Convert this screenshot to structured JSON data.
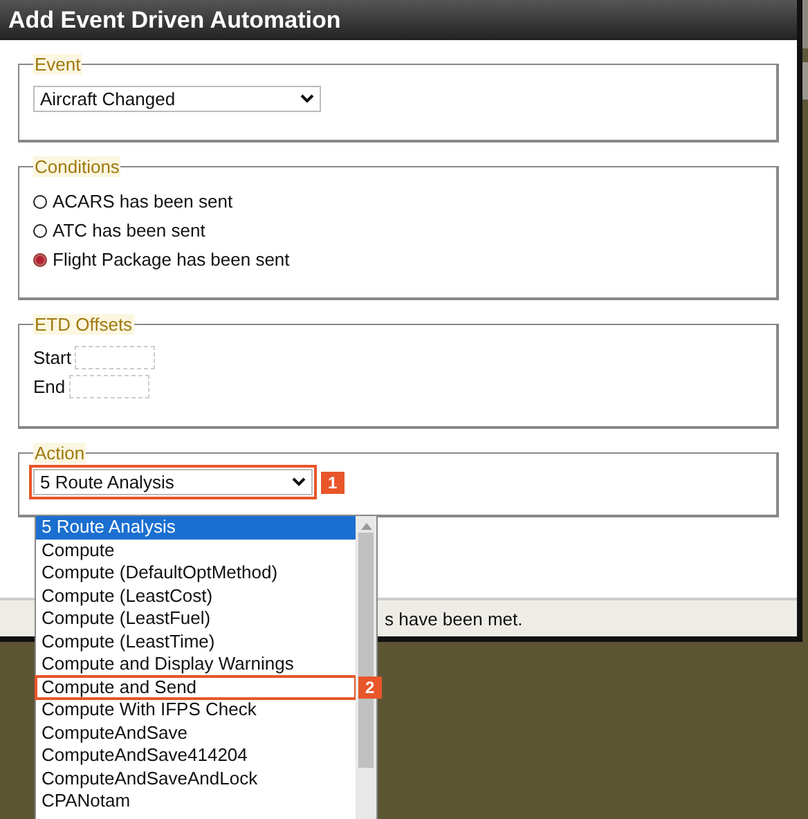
{
  "window": {
    "title": "Add Event Driven Automation"
  },
  "event": {
    "legend": "Event",
    "value": "Aircraft Changed"
  },
  "conditions": {
    "legend": "Conditions",
    "items": [
      {
        "label": "ACARS has been sent",
        "selected": false
      },
      {
        "label": "ATC has been sent",
        "selected": false
      },
      {
        "label": "Flight Package has been sent",
        "selected": true
      }
    ]
  },
  "etd_offsets": {
    "legend": "ETD Offsets",
    "fields": [
      {
        "label": "Start"
      },
      {
        "label": "End"
      }
    ]
  },
  "action": {
    "legend": "Action",
    "value": "5 Route Analysis",
    "callout": "1",
    "options": [
      {
        "label": "5 Route Analysis",
        "selected": true,
        "highlighted": false
      },
      {
        "label": "Compute",
        "selected": false,
        "highlighted": false
      },
      {
        "label": "Compute (DefaultOptMethod)",
        "selected": false,
        "highlighted": false
      },
      {
        "label": "Compute (LeastCost)",
        "selected": false,
        "highlighted": false
      },
      {
        "label": "Compute (LeastFuel)",
        "selected": false,
        "highlighted": false
      },
      {
        "label": "Compute (LeastTime)",
        "selected": false,
        "highlighted": false
      },
      {
        "label": "Compute and Display Warnings",
        "selected": false,
        "highlighted": false
      },
      {
        "label": "Compute and Send",
        "selected": false,
        "highlighted": true,
        "callout": "2"
      },
      {
        "label": "Compute With IFPS Check",
        "selected": false,
        "highlighted": false
      },
      {
        "label": "ComputeAndSave",
        "selected": false,
        "highlighted": false
      },
      {
        "label": "ComputeAndSave414204",
        "selected": false,
        "highlighted": false
      },
      {
        "label": "ComputeAndSaveAndLock",
        "selected": false,
        "highlighted": false
      },
      {
        "label": "CPANotam",
        "selected": false,
        "highlighted": false
      }
    ]
  },
  "footer": {
    "text": "s have been met."
  }
}
